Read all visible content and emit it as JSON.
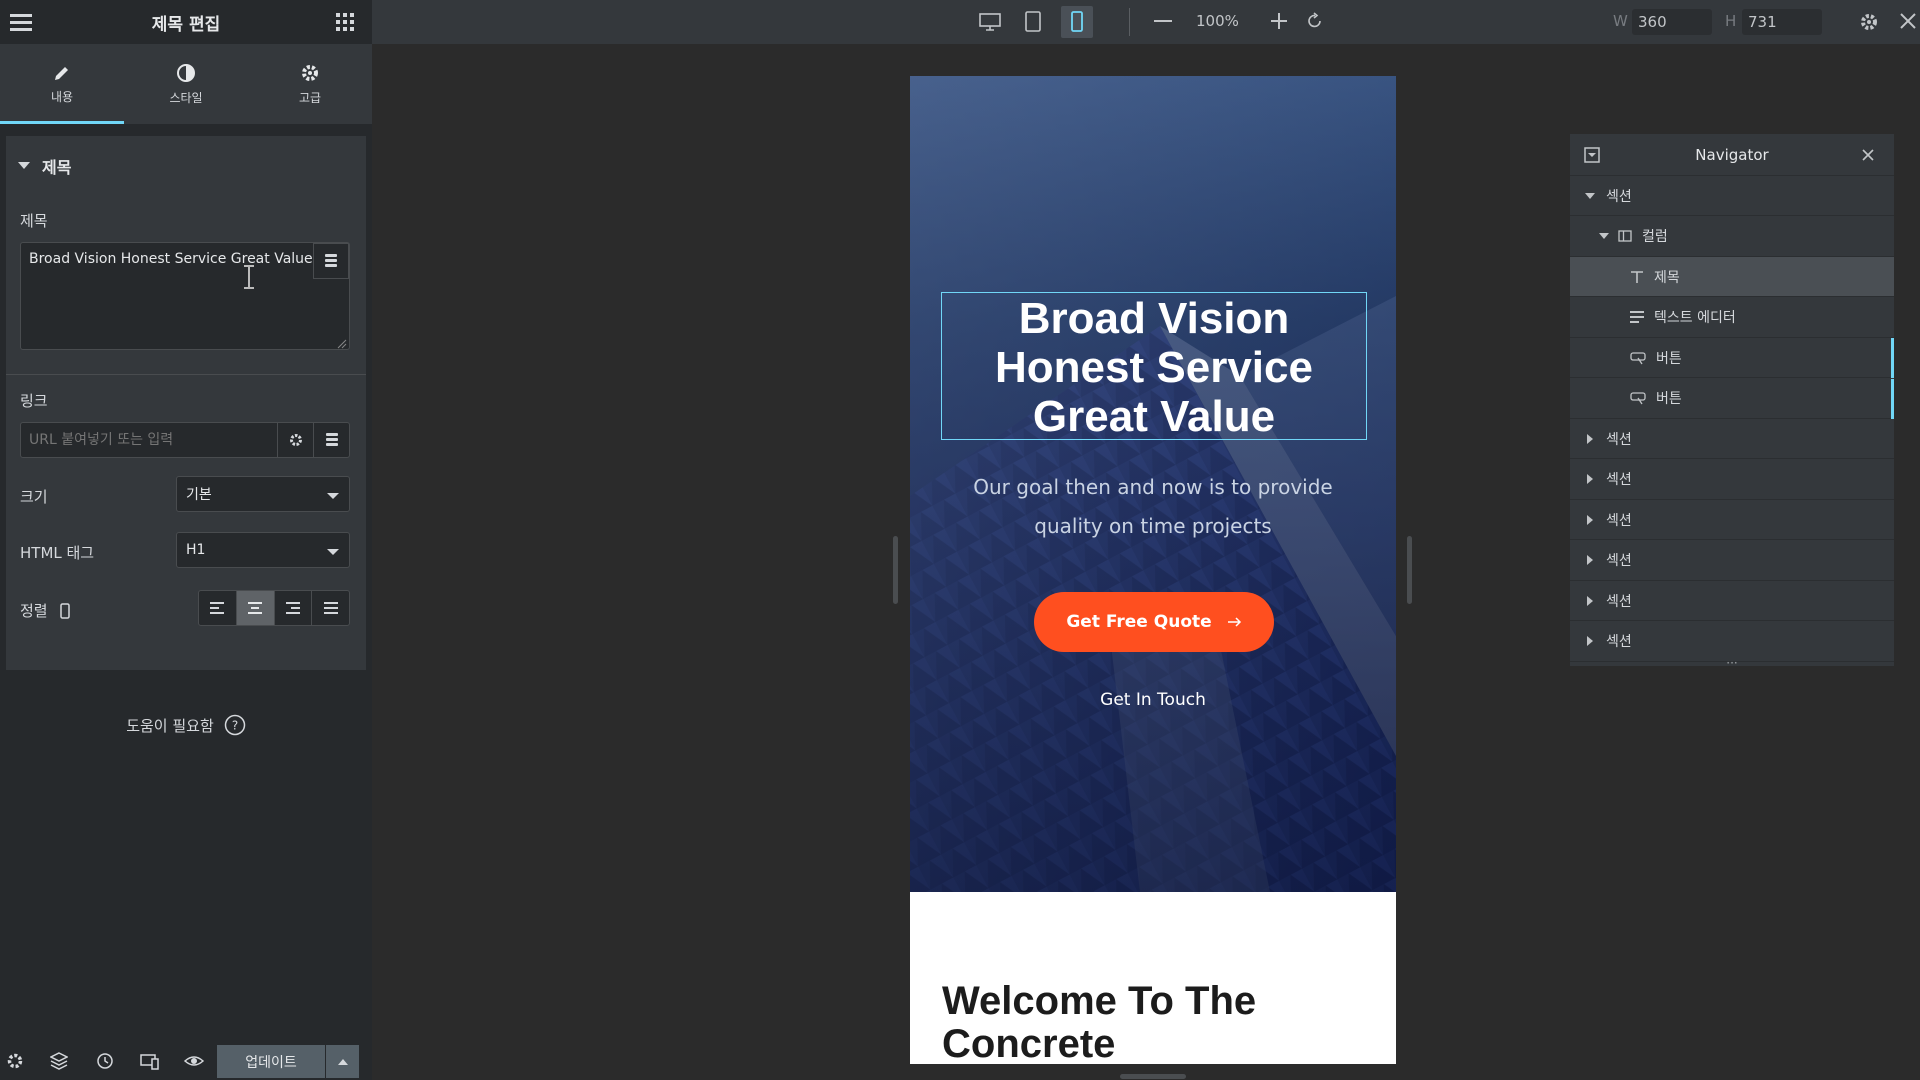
{
  "panel": {
    "title": "제목 편집",
    "tabs": [
      {
        "label": "내용",
        "icon": "pencil-icon"
      },
      {
        "label": "스타일",
        "icon": "half-circle-icon"
      },
      {
        "label": "고급",
        "icon": "gear-icon"
      }
    ],
    "section_title": "제목",
    "title_field": {
      "label": "제목",
      "value": "Broad Vision Honest Service Great Value"
    },
    "link_field": {
      "label": "링크",
      "placeholder": "URL 붙여넣기 또는 입력"
    },
    "size_field": {
      "label": "크기",
      "value": "기본"
    },
    "html_tag_field": {
      "label": "HTML 태그",
      "value": "H1"
    },
    "alignment": {
      "label": "정렬",
      "selected": "center"
    },
    "help_text": "도움이 필요함"
  },
  "footer": {
    "update_label": "업데이트"
  },
  "topbar": {
    "zoom": "100%",
    "width_label": "W",
    "width_value": "360",
    "height_label": "H",
    "height_value": "731",
    "selected_device": "mobile"
  },
  "preview": {
    "hero_heading": "Broad Vision Honest Service Great Value",
    "hero_subtitle": "Our goal then and now is to provide quality on time projects",
    "primary_button": "Get Free Quote",
    "secondary_link": "Get In Touch",
    "welcome_heading": "Welcome To The Concrete"
  },
  "navigator": {
    "title": "Navigator",
    "items": [
      {
        "label": "섹션",
        "level": 0,
        "expanded": true
      },
      {
        "label": "컬럼",
        "level": 1,
        "expanded": true
      },
      {
        "label": "제목",
        "level": 2,
        "selected": true
      },
      {
        "label": "텍스트 에디터",
        "level": 2
      },
      {
        "label": "버튼",
        "level": 2
      },
      {
        "label": "버튼",
        "level": 2
      },
      {
        "label": "섹션",
        "level": 0
      },
      {
        "label": "섹션",
        "level": 0
      },
      {
        "label": "섹션",
        "level": 0
      },
      {
        "label": "섹션",
        "level": 0
      },
      {
        "label": "섹션",
        "level": 0
      },
      {
        "label": "섹션",
        "level": 0
      }
    ]
  },
  "colors": {
    "accent": "#71d7f7",
    "cta": "#ff4f1f",
    "panel_bg": "#26292c",
    "panel_section_bg": "#34383c",
    "canvas_bg": "#2b2b2b"
  }
}
